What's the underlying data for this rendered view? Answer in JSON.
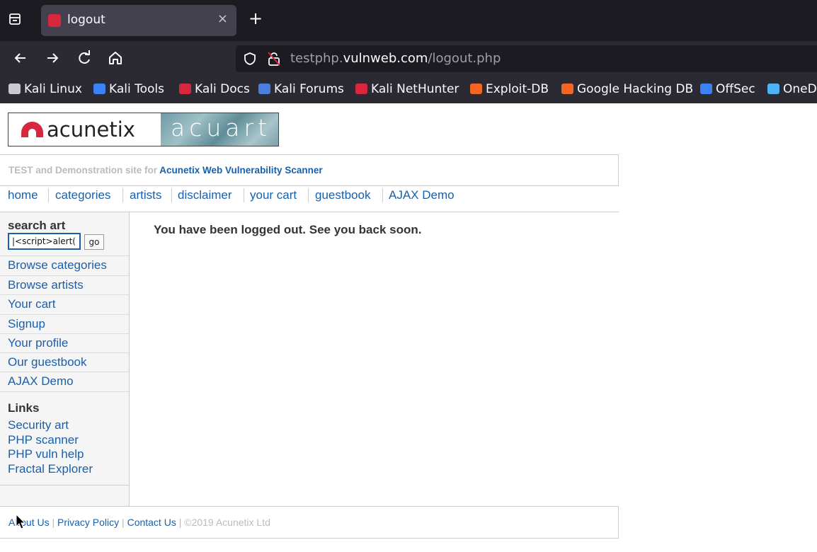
{
  "browser": {
    "tab_title": "logout",
    "close_glyph": "×",
    "new_tab_glyph": "+",
    "url_prefix": "testphp.",
    "url_domain": "vulnweb.com",
    "url_path": "/logout.php",
    "bookmarks": [
      {
        "label": "Kali Linux",
        "icon": "kali-dragon-icon",
        "color": "#c9c9cf"
      },
      {
        "label": "Kali Tools",
        "icon": "kali-tools-icon",
        "color": "#3b82f6"
      },
      {
        "label": "Kali Docs",
        "icon": "kali-docs-icon",
        "color": "#d7263d"
      },
      {
        "label": "Kali Forums",
        "icon": "kali-forums-icon",
        "color": "#4a7fe0"
      },
      {
        "label": "Kali NetHunter",
        "icon": "nethunter-icon",
        "color": "#d7263d"
      },
      {
        "label": "Exploit-DB",
        "icon": "exploit-db-icon",
        "color": "#f26522"
      },
      {
        "label": "Google Hacking DB",
        "icon": "ghdb-icon",
        "color": "#f26522"
      },
      {
        "label": "OffSec",
        "icon": "offsec-icon",
        "color": "#3b82f6"
      },
      {
        "label": "OneD",
        "icon": "onedrive-icon",
        "color": "#4fb2f5"
      }
    ]
  },
  "site": {
    "logo_left": "acunetix",
    "logo_right": "acuart",
    "tagline_prefix": "TEST and Demonstration site for ",
    "tagline_link": "Acunetix Web Vulnerability Scanner",
    "nav": [
      "home",
      "categories",
      "artists",
      "disclaimer",
      "your cart",
      "guestbook",
      "AJAX Demo"
    ],
    "search_title": "search art",
    "search_value": "|<script>alert(",
    "go_label": "go",
    "side_links": [
      "Browse categories",
      "Browse artists",
      "Your cart",
      "Signup",
      "Your profile",
      "Our guestbook",
      "AJAX Demo"
    ],
    "links_title": "Links",
    "external_links": [
      "Security art",
      "PHP scanner",
      "PHP vuln help",
      "Fractal Explorer"
    ],
    "message": "You have been logged out. See you back soon.",
    "footer": {
      "about": "About Us",
      "privacy": "Privacy Policy",
      "contact": "Contact Us",
      "separator": "|",
      "copyright": "©2019 Acunetix Ltd"
    },
    "link_color": "#1b5fa8",
    "accent_color": "#d7263d"
  }
}
